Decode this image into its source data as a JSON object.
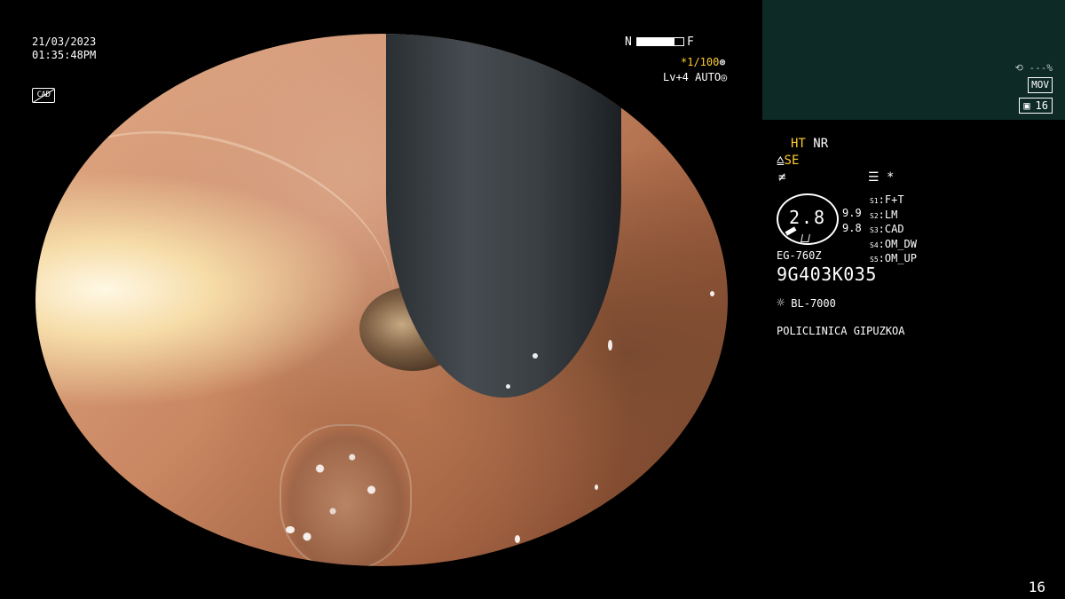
{
  "datetime": {
    "date": "21/03/2023",
    "time": "01:35:48PM"
  },
  "cad_icon": {
    "text": "CAD"
  },
  "nf": {
    "near": "N",
    "far": "F",
    "level": 0.8
  },
  "shutter": {
    "star": "*",
    "value": "1/100",
    "icon": "⊛"
  },
  "level_line": {
    "level": "Lv+4",
    "mode": "AUTO",
    "icon": "◎"
  },
  "preview": {
    "record_percent": "---%",
    "record_icon": "⟲",
    "mov_label": "MOV",
    "capture_count": "16",
    "camera_icon": "▣"
  },
  "image_settings": {
    "ht": "HT",
    "nr": "NR",
    "se_icon": "⩠",
    "se": "SE",
    "f_icon": "≠",
    "menu_icon": "☰",
    "asterisk": "*"
  },
  "zoom": {
    "value": "2.8",
    "right_top": "9.9",
    "right_bottom": "9.8"
  },
  "switches": [
    {
      "num": "S1",
      "label": "F+T"
    },
    {
      "num": "S2",
      "label": "LM"
    },
    {
      "num": "S3",
      "label": "CAD"
    },
    {
      "num": "S4",
      "label": "OM_DW"
    },
    {
      "num": "S5",
      "label": "OM_UP"
    }
  ],
  "scope_model": "EG-760Z",
  "serial": "9G403K035",
  "light_source": {
    "icon": "☼",
    "label": "BL-7000"
  },
  "institution": "POLICLINICA GIPUZKOA",
  "page_number": "16"
}
